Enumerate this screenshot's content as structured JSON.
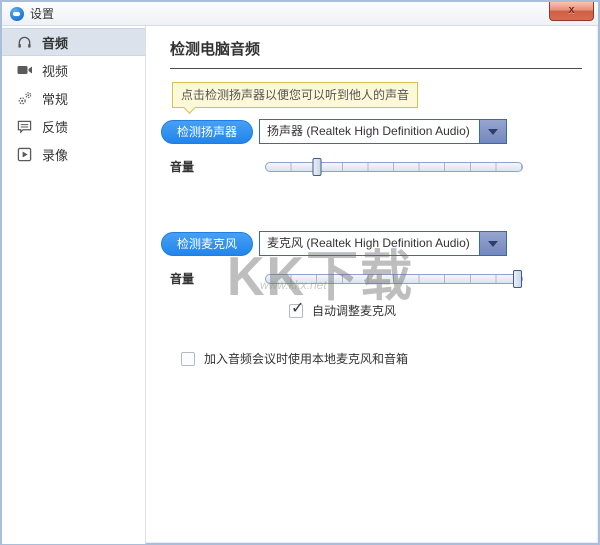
{
  "window": {
    "title": "设置",
    "close_label": "x"
  },
  "sidebar": {
    "items": [
      {
        "label": "音频",
        "icon": "headphones-icon",
        "selected": true
      },
      {
        "label": "视频",
        "icon": "video-camera-icon",
        "selected": false
      },
      {
        "label": "常规",
        "icon": "gears-icon",
        "selected": false
      },
      {
        "label": "反馈",
        "icon": "feedback-bubble-icon",
        "selected": false
      },
      {
        "label": "录像",
        "icon": "recording-play-icon",
        "selected": false
      }
    ]
  },
  "main": {
    "title": "检测电脑音频",
    "tooltip": "点击检测扬声器以便您可以听到他人的声音",
    "speaker": {
      "test_button": "检测扬声器",
      "device": "扬声器 (Realtek High Definition Audio)",
      "volume_label": "音量",
      "volume_percent": 20
    },
    "microphone": {
      "test_button": "检测麦克风",
      "device": "麦克风 (Realtek High Definition Audio)",
      "volume_label": "音量",
      "volume_percent": 100,
      "auto_adjust_label": "自动调整麦克风",
      "auto_adjust_checked": true,
      "check_glyph": "✓"
    },
    "join_option": {
      "label": "加入音频会议时使用本地麦克风和音箱",
      "checked": false
    }
  },
  "watermark": {
    "text": "KK下载",
    "subtext": "www.kkx.net"
  },
  "colors": {
    "accent_blue": "#2b8cf0",
    "combo_border": "#3d68b0",
    "combo_arrow_bg": "#8496c6",
    "selected_item_bg": "#dbe2ec",
    "tooltip_bg": "#fdf8d7",
    "tooltip_border": "#d2c153",
    "close_button_red": "#d96b50",
    "slider_border": "#8fa3c8"
  }
}
